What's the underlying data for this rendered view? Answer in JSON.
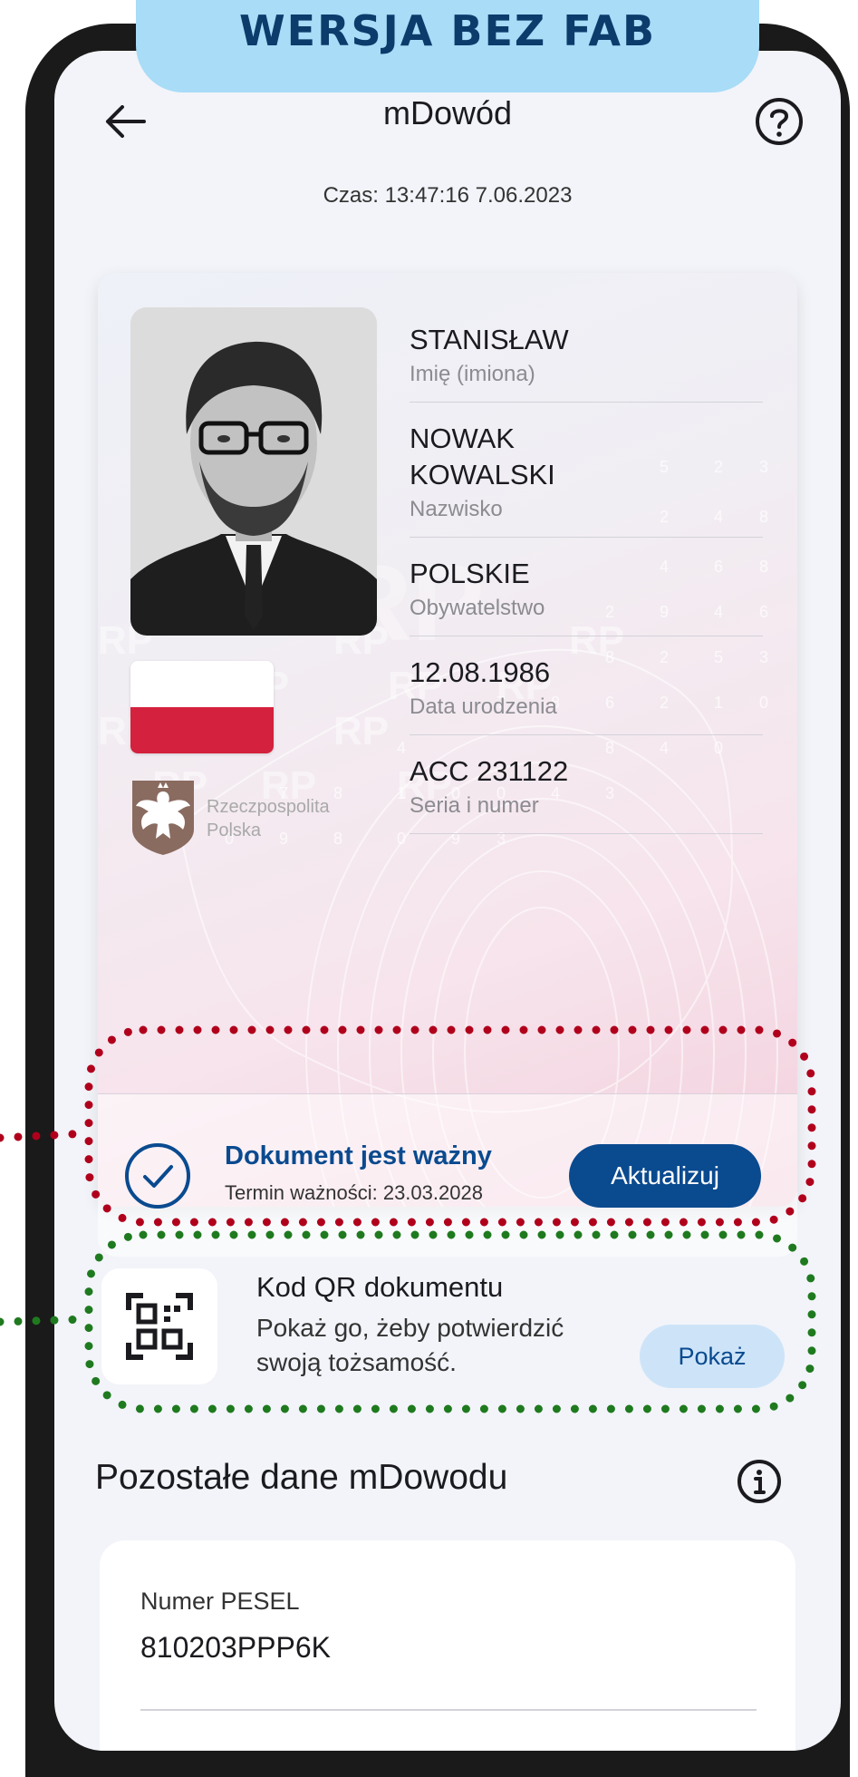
{
  "banner": {
    "label": "WERSJA BEZ FAB"
  },
  "header": {
    "title": "mDowód",
    "time": "Czas: 13:47:16 7.06.2023"
  },
  "card": {
    "fields": [
      {
        "value": "STANISŁAW",
        "label": "Imię (imiona)"
      },
      {
        "value": "NOWAK\nKOWALSKI",
        "label": "Nazwisko"
      },
      {
        "value": "POLSKIE",
        "label": "Obywatelstwo"
      },
      {
        "value": "12.08.1986",
        "label": "Data urodzenia"
      },
      {
        "value": "ACC 231122",
        "label": "Seria i numer"
      }
    ],
    "emblem_text_line1": "Rzeczpospolita",
    "emblem_text_line2": "Polska",
    "watermark_text": "RP"
  },
  "validity": {
    "title": "Dokument jest ważny",
    "subtitle": "Termin ważności: 23.03.2028",
    "button": "Aktualizuj"
  },
  "qr": {
    "title": "Kod QR dokumentu",
    "description": "Pokaż go, żeby potwierdzić swoją tożsamość.",
    "button": "Pokaż"
  },
  "other": {
    "title": "Pozostałe dane mDowodu"
  },
  "pesel": {
    "label": "Numer PESEL",
    "value": "810203PPP6K"
  },
  "colors": {
    "primary": "#0a4a8f",
    "banner": "#a8dcf7",
    "flag_red": "#d4213d",
    "annotation_red": "#b0001c",
    "annotation_green": "#1f7a1f"
  },
  "icons": {
    "back": "arrow-left-icon",
    "help": "question-circle-icon",
    "check": "check-circle-icon",
    "qr": "qr-code-icon",
    "info": "info-circle-icon"
  }
}
